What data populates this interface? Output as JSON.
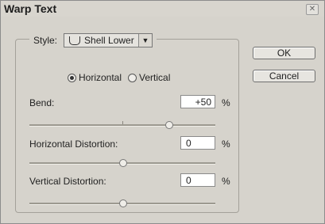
{
  "window": {
    "title": "Warp Text"
  },
  "style": {
    "label": "Style:",
    "selected": "Shell Lower"
  },
  "orientation": {
    "horizontal": "Horizontal",
    "vertical": "Vertical",
    "selected": "horizontal"
  },
  "bend": {
    "label": "Bend:",
    "value": "+50",
    "unit": "%",
    "slider_percent": 75
  },
  "horizontal_distortion": {
    "label": "Horizontal Distortion:",
    "value": "0",
    "unit": "%",
    "slider_percent": 50
  },
  "vertical_distortion": {
    "label": "Vertical Distortion:",
    "value": "0",
    "unit": "%",
    "slider_percent": 50
  },
  "buttons": {
    "ok": "OK",
    "cancel": "Cancel"
  }
}
